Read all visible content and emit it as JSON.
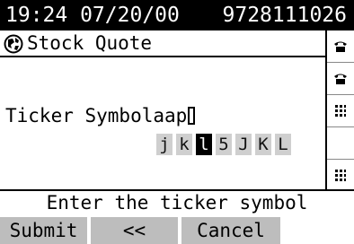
{
  "status": {
    "datetime": "19:24 07/20/00",
    "phone_number": "9728111026"
  },
  "app": {
    "title": "Stock Quote",
    "icon": "globe-icon"
  },
  "form": {
    "label": "Ticker Symbol",
    "value": "aap"
  },
  "letter_picker": {
    "letters": [
      "j",
      "k",
      "l",
      "5",
      "J",
      "K",
      "L"
    ],
    "selected_index": 2
  },
  "side_keys": [
    "phone-icon",
    "phone-icon",
    "keypad-icon",
    "",
    "",
    "keypad-icon"
  ],
  "hint": "Enter the ticker symbol",
  "softkeys": {
    "submit": "Submit",
    "back": "<<",
    "cancel": "Cancel"
  }
}
